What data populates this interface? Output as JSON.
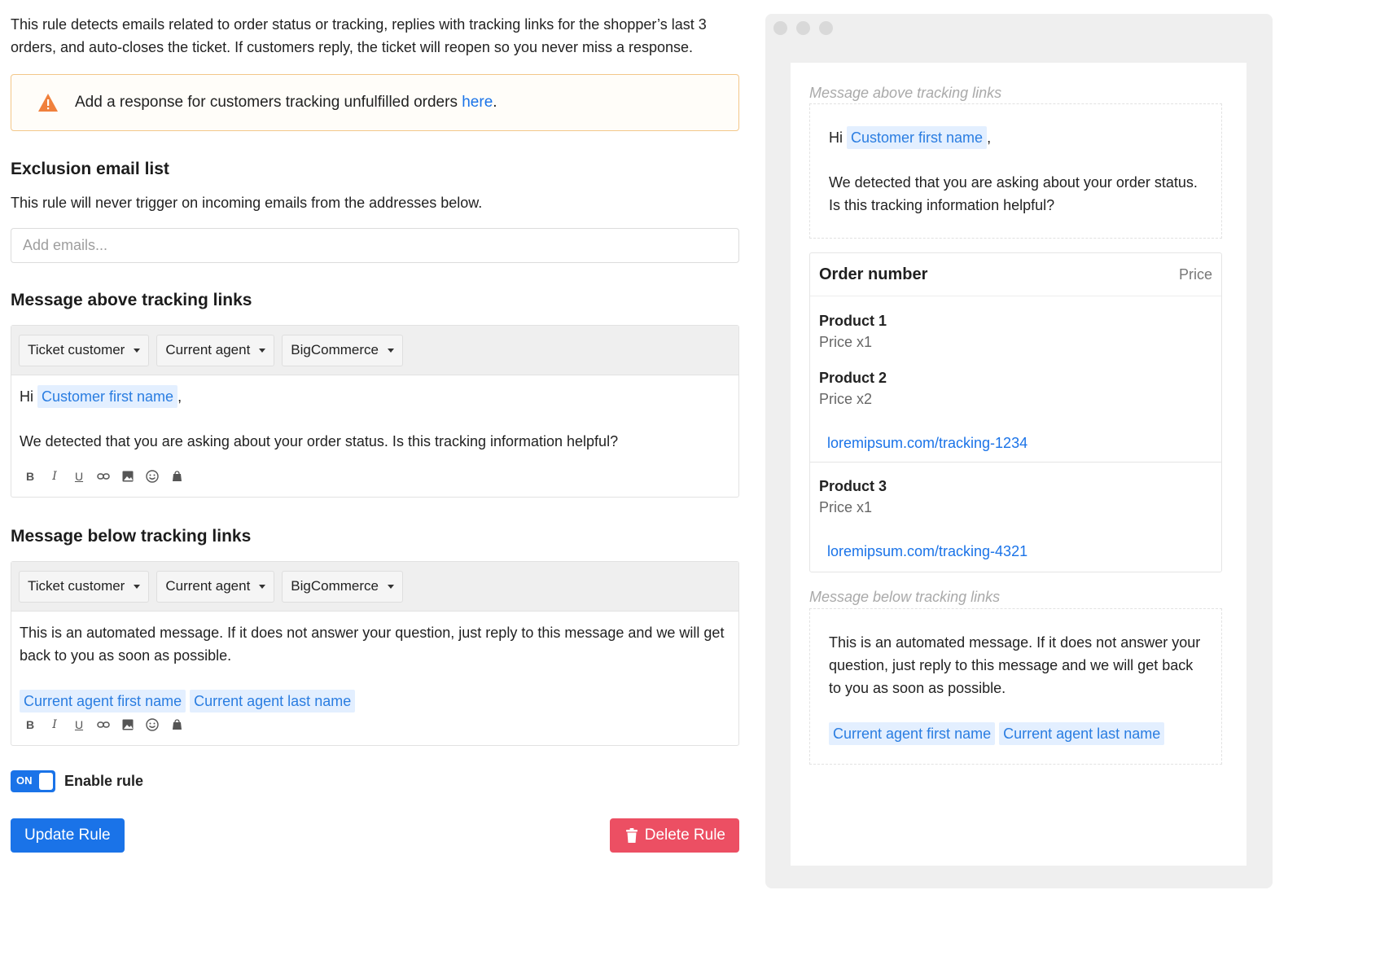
{
  "intro": "This rule detects emails related to order status or tracking, replies with tracking links for the shopper’s last 3 orders, and auto-closes the ticket. If customers reply, the ticket will reopen so you never miss a response.",
  "alert": {
    "text": "Add a response for customers tracking unfulfilled orders ",
    "link": "here",
    "suffix": ".",
    "accent": "#f3c78a"
  },
  "exclusion": {
    "title": "Exclusion email list",
    "description": "This rule will never trigger on incoming emails from the addresses below.",
    "placeholder": "Add emails..."
  },
  "above": {
    "title": "Message above tracking links",
    "vars": [
      "Ticket customer",
      "Current agent",
      "BigCommerce"
    ],
    "greeting": "Hi",
    "greeting_tag": "Customer first name",
    "greeting_suffix": ",",
    "body": "We detected that you are asking about your order status. Is this tracking information helpful?"
  },
  "below": {
    "title": "Message below tracking links",
    "vars": [
      "Ticket customer",
      "Current agent",
      "BigCommerce"
    ],
    "body": "This is an automated message. If it does not answer your question, just reply to this message and we will get back to you as soon as possible.",
    "tags": [
      "Current agent first name",
      "Current agent last name"
    ]
  },
  "format_icons": [
    "bold-icon",
    "italic-icon",
    "underline-icon",
    "link-icon",
    "image-icon",
    "emoji-icon",
    "shopify-bag-icon"
  ],
  "toggle": {
    "state": "ON",
    "label": "Enable rule"
  },
  "buttons": {
    "update": "Update Rule",
    "delete": "Delete Rule"
  },
  "colors": {
    "primary": "#1a73e8",
    "danger": "#ec4f63",
    "tag_bg": "#e3efff",
    "tag_text": "#2a7de1"
  },
  "preview": {
    "above_label": "Message above tracking links",
    "greeting": "Hi",
    "greeting_tag": "Customer first name",
    "greeting_suffix": ",",
    "above_body": "We detected that you are asking about your order status. Is this tracking information helpful?",
    "order_header": "Order number",
    "price_header": "Price",
    "products": [
      {
        "name": "Product 1",
        "price": "Price x1"
      },
      {
        "name": "Product 2",
        "price": "Price x2"
      },
      {
        "name": "Product 3",
        "price": "Price x1"
      }
    ],
    "tracking": [
      "loremipsum.com/tracking-1234",
      "loremipsum.com/tracking-4321"
    ],
    "below_label": "Message below tracking links",
    "below_body": "This is an automated message. If it does not answer your question, just reply to this message and we will get back to you as soon as possible.",
    "below_tags": [
      "Current agent first name",
      "Current agent last name"
    ]
  }
}
